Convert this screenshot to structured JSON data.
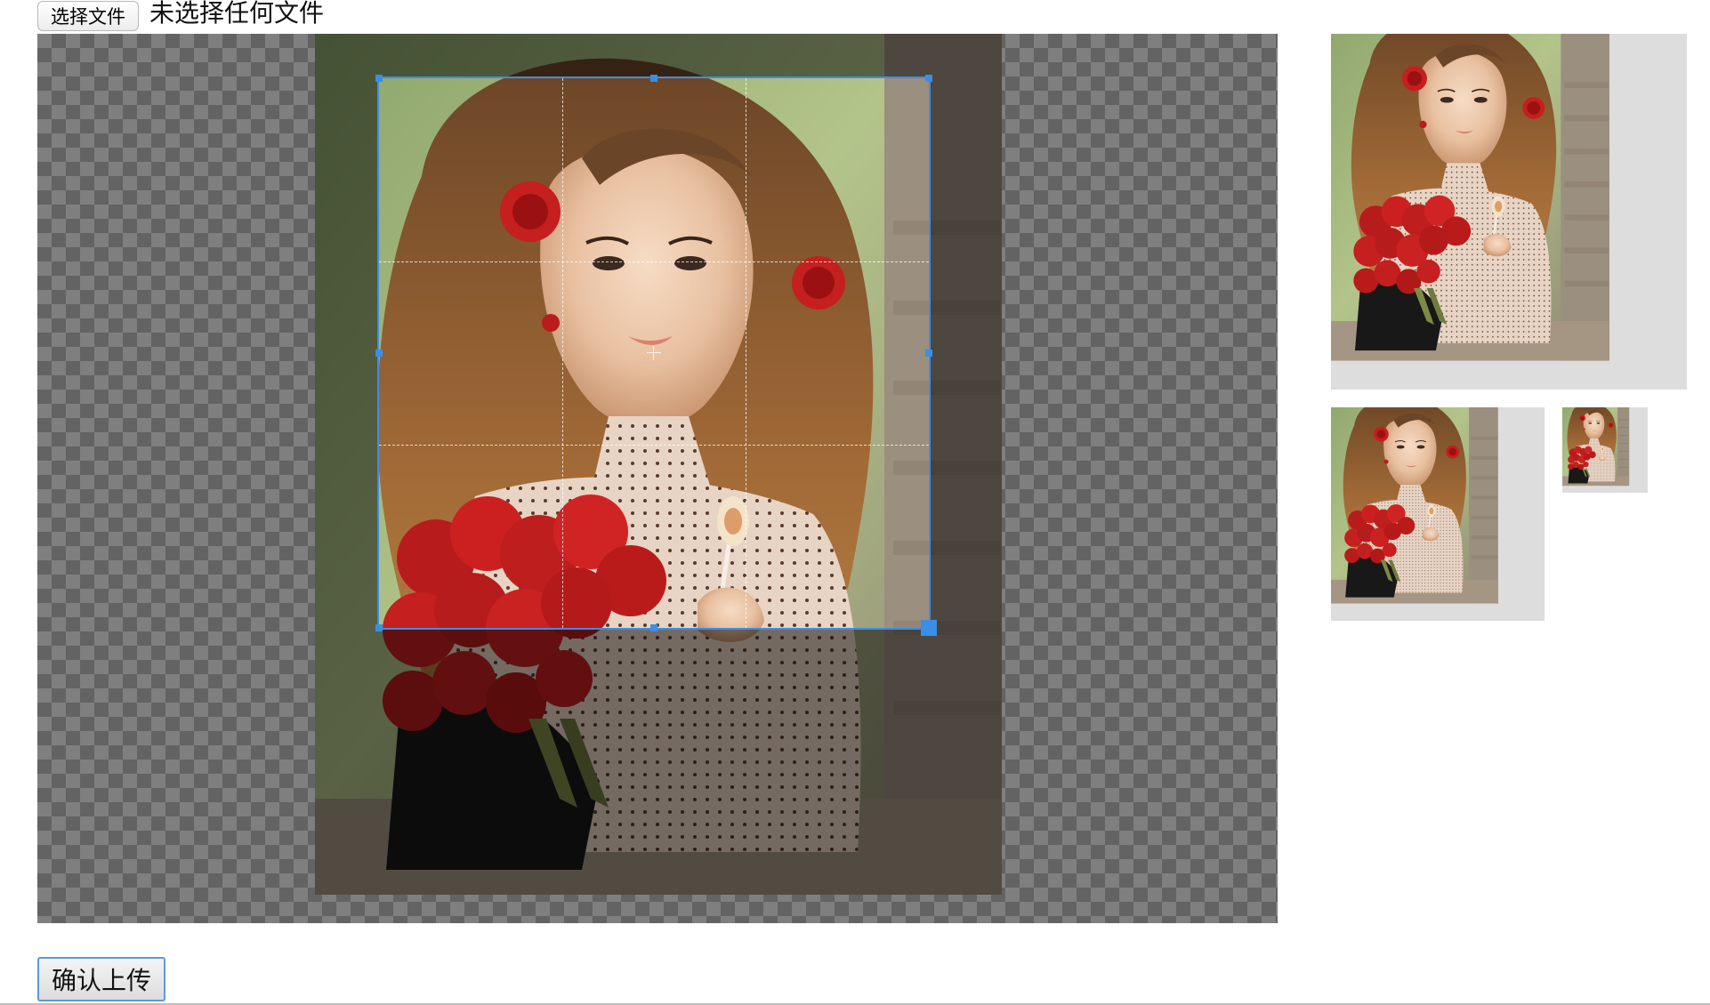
{
  "file_input": {
    "button_label": "选择文件",
    "status_text": "未选择任何文件"
  },
  "actions": {
    "confirm_upload_label": "确认上传"
  },
  "theme": {
    "accent": "#3b8ee6",
    "checker_light": "#ffffff",
    "checker_dark": "#c6c6c6"
  }
}
